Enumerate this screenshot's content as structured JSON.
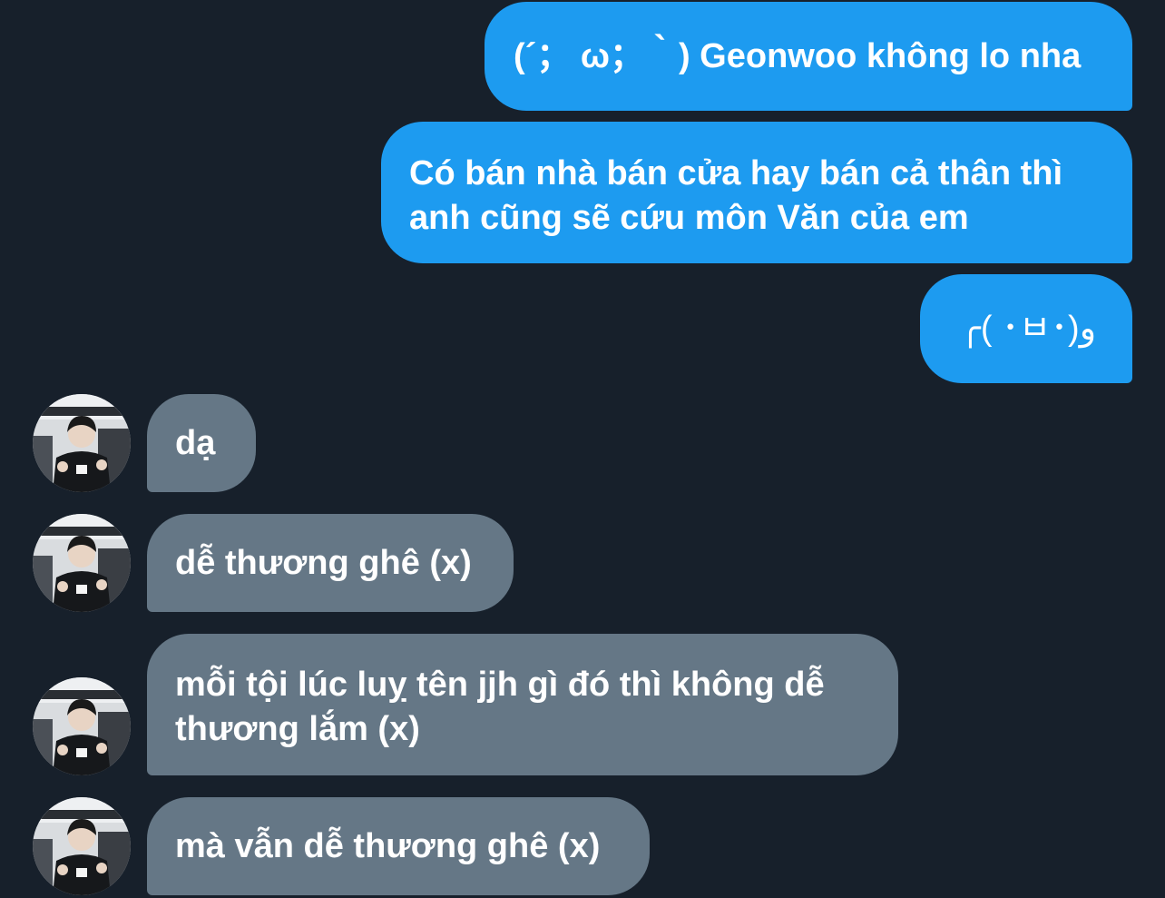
{
  "theme": {
    "background": "#17202b",
    "sent_bubble_color": "#1d9bf0",
    "received_bubble_color": "#657786",
    "text_color": "#ffffff"
  },
  "messages": [
    {
      "direction": "sent",
      "text": "(´； ω；｀) Geonwoo không lo nha"
    },
    {
      "direction": "sent",
      "text": "Có bán nhà bán cửa hay bán cả thân thì\nanh cũng sẽ cứu môn Văn của em"
    },
    {
      "direction": "sent",
      "text": "╭( ･ㅂ･)و"
    },
    {
      "direction": "received",
      "text": "dạ",
      "avatar": "user-avatar"
    },
    {
      "direction": "received",
      "text": "dễ thương ghê (x)",
      "avatar": "user-avatar"
    },
    {
      "direction": "received",
      "text": "mỗi tội lúc luỵ tên jjh gì đó thì không dễ\nthương lắm (x)",
      "avatar": "user-avatar"
    },
    {
      "direction": "received",
      "text": "mà vẫn dễ thương ghê (x)",
      "avatar": "user-avatar"
    }
  ]
}
